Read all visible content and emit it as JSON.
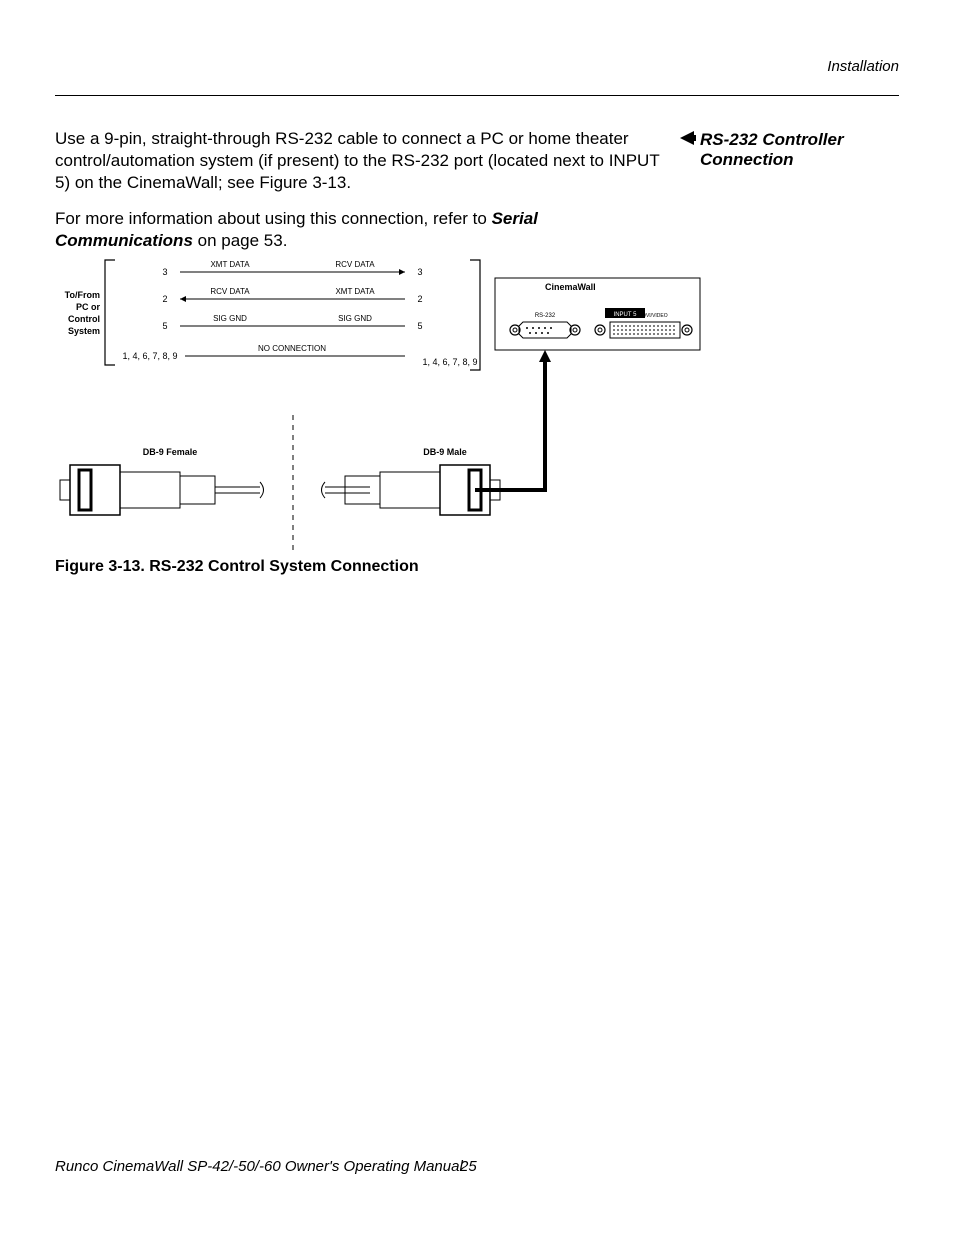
{
  "header": {
    "section": "Installation"
  },
  "sidehead": {
    "line1": "RS-232 Controller",
    "line2": "Connection"
  },
  "body": {
    "para1": "Use a 9-pin, straight-through RS-232 cable to connect a PC or home theater control/automation system (if present) to the RS-232 port (located next to INPUT 5) on the CinemaWall; see Figure 3-13.",
    "para2_a": "For more information about using this connection, refer to ",
    "para2_b": "Serial Communications",
    "para2_c": " on page 53."
  },
  "diagram": {
    "left_label_1": "To/From",
    "left_label_2": "PC or",
    "left_label_3": "Control",
    "left_label_4": "System",
    "pin3": "3",
    "pin2": "2",
    "pin5": "5",
    "pin_rest": "1, 4, 6, 7, 8, 9",
    "xmt": "XMT DATA",
    "rcv": "RCV DATA",
    "gnd": "SIG GND",
    "noconn": "NO CONNECTION",
    "db9f": "DB-9 Female",
    "db9m": "DB-9 Male",
    "box_title": "CinemaWall",
    "rs232_lbl": "RS-232",
    "input5_lbl": "INPUT 5",
    "dvivideo_lbl": "DVI/VIDEO"
  },
  "caption": "Figure 3-13. RS-232 Control System Connection",
  "footer": {
    "text": "Runco CinemaWall SP-42/-50/-60 Owner's Operating Manual",
    "page": "25"
  }
}
